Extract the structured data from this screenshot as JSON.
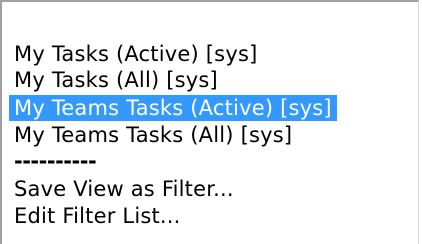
{
  "listbox": {
    "items": [
      {
        "label": "My Tasks (Active) [sys]",
        "selected": false
      },
      {
        "label": "My Tasks (All) [sys]",
        "selected": false
      },
      {
        "label": "My Teams Tasks (Active) [sys]",
        "selected": true
      },
      {
        "label": "My Teams Tasks (All) [sys]",
        "selected": false
      },
      {
        "label": "----------",
        "selected": false
      },
      {
        "label": "Save View as Filter...",
        "selected": false
      },
      {
        "label": "Edit Filter List...",
        "selected": false
      }
    ],
    "selection_color": "#3399ff",
    "selection_text_color": "#ffffff"
  }
}
